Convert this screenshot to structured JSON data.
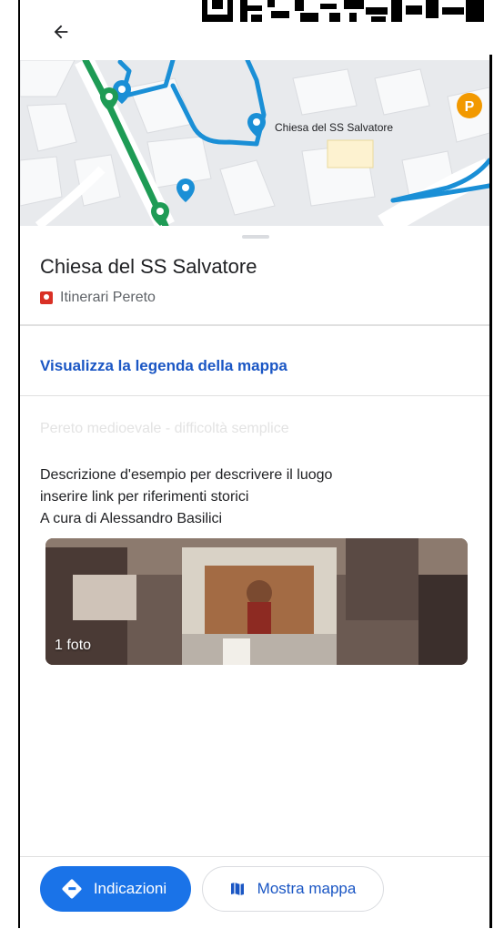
{
  "map": {
    "place_label": "Chiesa del SS Salvatore",
    "parking_letter": "P"
  },
  "place": {
    "title": "Chiesa del SS Salvatore",
    "map_name": "Itinerari Pereto"
  },
  "legend_link": "Visualizza la legenda della mappa",
  "layer_name": "Pereto medioevale - difficoltà semplice",
  "description": [
    "Descrizione d'esempio per descrivere il luogo",
    "inserire link per riferimenti storici",
    "A cura di Alessandro Basilici"
  ],
  "photo": {
    "label": "1 foto"
  },
  "buttons": {
    "directions": "Indicazioni",
    "show_map": "Mostra mappa"
  },
  "colors": {
    "accent": "#1a73e8",
    "link": "#1a56c4",
    "route_green": "#1e9b55",
    "route_blue": "#1a8fd6"
  }
}
